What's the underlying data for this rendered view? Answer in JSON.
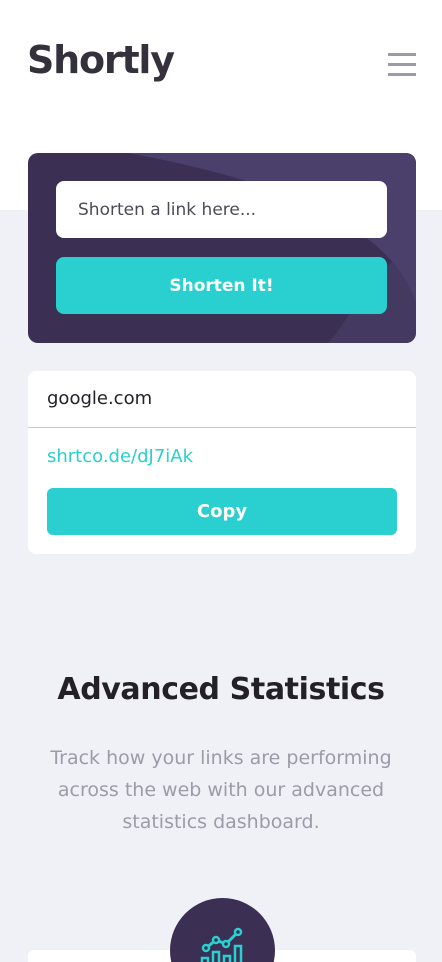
{
  "header": {
    "logo": "Shortly",
    "menu_icon": "hamburger-menu-icon"
  },
  "shorten": {
    "placeholder": "Shorten a link here...",
    "button_label": "Shorten It!"
  },
  "result": {
    "original_url": "google.com",
    "short_url": "shrtco.de/dJ7iAk",
    "copy_label": "Copy"
  },
  "statistics": {
    "title": "Advanced Statistics",
    "description": "Track how your links are performing across the web with our advanced statistics dashboard."
  },
  "feature": {
    "icon": "chart-growth-icon"
  },
  "colors": {
    "brand_dark": "#3b3054",
    "accent_cyan": "#2acfcf",
    "background_gray": "#eff1f7",
    "text_dark": "#34313d",
    "text_gray": "#9e9aa7"
  }
}
